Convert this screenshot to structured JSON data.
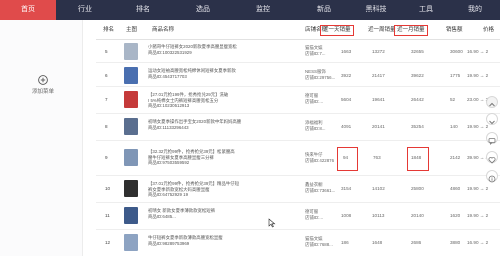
{
  "nav": {
    "items": [
      "首页",
      "行业",
      "排名",
      "选品",
      "监控",
      "新品",
      "黑科技",
      "工具",
      "我的"
    ],
    "active_index": 0
  },
  "left": {
    "add_label": "添加菜单"
  },
  "table": {
    "headers": {
      "rank": "排名",
      "main_image": "主图",
      "product_name": "商品名称",
      "shop": "店铺名称",
      "sales_1d": "近一天销量",
      "sales_7d": "近一周销量",
      "sales_30d": "近一月销量",
      "sales_amount": "销售额",
      "price": "价格"
    },
    "rows": [
      {
        "rank": "5",
        "title1": "小猪哥牛仔短裤女2020新款夏季高腰显瘦宽松",
        "title2": "商品ID:100322531929",
        "title3": "",
        "shop1": "猫猫文娱",
        "shop2": "店铺ID:7...",
        "d1": "1663",
        "d7": "13272",
        "d30": "32655",
        "amount": "30600",
        "price": "16.90 → 2",
        "thumb": "#a9b6c7"
      },
      {
        "rank": "6",
        "title1": "运动女短袖高腰宽松纯棉休闲短裤女夏季新款",
        "title2": "商品ID:4543717703",
        "title3": "",
        "shop1": "NESS服饰",
        "shop2": "店铺ID:29756...",
        "d1": "3922",
        "d7": "21417",
        "d30": "39622",
        "amount": "1775",
        "price": "19.90 → 2",
        "thumb": "#4a6fb0"
      },
      {
        "rank": "7",
        "title1": "【27.01元抢199件，抢秀抢兑29元】洗破",
        "title2": "I 5%纯棉女士内裤短裤高腰宽松五分",
        "title3": "商品ID:10230512913",
        "shop1": "德可服",
        "shop2": "店铺ID:...",
        "d1": "5604",
        "d7": "19641",
        "d30": "26442",
        "amount": "52",
        "price": "23.00 → 2",
        "thumb": "#c53a3a"
      },
      {
        "rank": "8",
        "title1": "初晴女夏季操作出手宝女2020新款中年妈妈高腰",
        "title2": "商品ID:11133296443",
        "title3": "",
        "shop1": "添福福利",
        "shop2": "店铺ID:8...",
        "d1": "4091",
        "d7": "20141",
        "d30": "35254",
        "amount": "140",
        "price": "19.90 → 2",
        "thumb": "#5a6e8f"
      },
      {
        "rank": "9",
        "title1": "【32.32元抢99件，抢秀抢兑39元】松紧腰高",
        "title2": "腰牛仔短裤女夏季高腰显瘦三分裤",
        "title3": "商品ID:97503559592",
        "shop1": "快来牛仔",
        "shop2": "店铺ID:422876",
        "d1": "94",
        "d7": "763",
        "d30": "1848",
        "amount": "2142",
        "price": "39.90 → 4",
        "thumb": "#7f96b6"
      },
      {
        "rank": "10",
        "title1": "【37.01元抢99件，抢秀抢兑39元】精品牛仔短",
        "title2": "裤女夏季新款宽松大码高腰显瘦",
        "title3": "商品ID:64752929 19",
        "shop1": "鑫益衣橱",
        "shop2": "店铺ID:73661...",
        "d1": "3154",
        "d7": "14102",
        "d30": "25800",
        "amount": "4860",
        "price": "19.90 → 2",
        "thumb": "#2f2f2f"
      },
      {
        "rank": "11",
        "title1": "初晴女 新款女夏季薄款款宽松短裤",
        "title2": "商品ID:6485...",
        "title3": "",
        "shop1": "德可服",
        "shop2": "店铺ID:...",
        "d1": "1008",
        "d7": "10113",
        "d30": "20140",
        "amount": "1620",
        "price": "19.90 → 2",
        "thumb": "#3d5a8a"
      },
      {
        "rank": "12",
        "title1": "牛仔短裤女夏季新款薄款高腰宽松显瘦",
        "title2": "商品ID:98289753969",
        "title3": "",
        "shop1": "猫猫文娱",
        "shop2": "店铺ID:7688...",
        "d1": "186",
        "d7": "1648",
        "d30": "2686",
        "amount": "3880",
        "price": "16.90 → 2",
        "thumb": "#8da3c2"
      }
    ]
  },
  "colors": {
    "nav_bg": "#2b3149",
    "accent": "#e04b4b",
    "highlight_box": "#e53935"
  },
  "icons": [
    "plus-circle-icon",
    "arrow-up-icon",
    "arrow-down-icon",
    "chat-icon",
    "heart-icon",
    "help-icon",
    "cursor-icon"
  ]
}
